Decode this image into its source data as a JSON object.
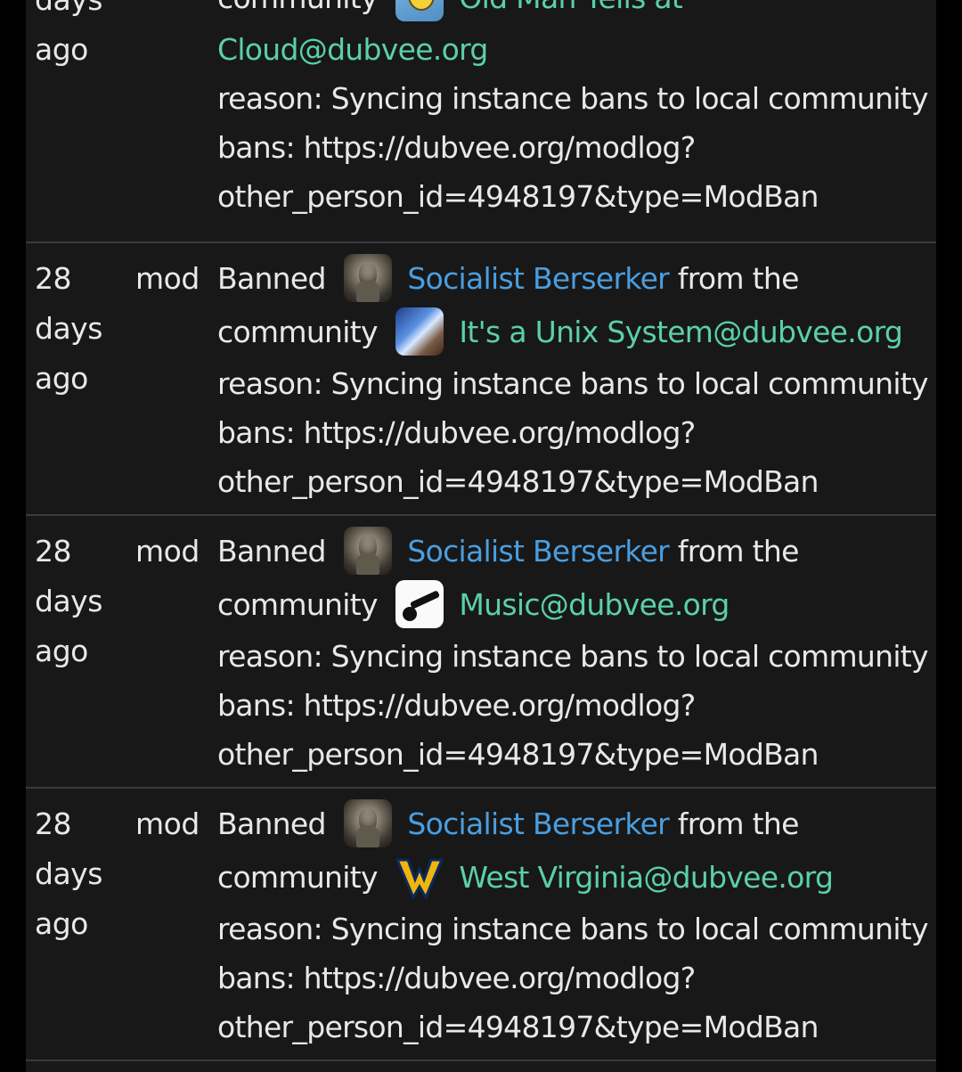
{
  "top_partial": {
    "time_lines": [
      "days",
      "ago"
    ],
    "community_word": "community",
    "community_avatar": "old-man-yells-avatar",
    "community_link_line1": "Old Man Yells at",
    "community_link_line2": "Cloud@dubvee.org",
    "reason_line1": "reason: Syncing instance bans to local community",
    "reason_line2": "bans: https://dubvee.org/modlog?",
    "reason_line3": "other_person_id=4948197&type=ModBan"
  },
  "entries": [
    {
      "time_lines": [
        "28",
        "days",
        "ago"
      ],
      "role": "mod",
      "banned_word": "Banned",
      "user": "Socialist Berserker",
      "from_the": "from the",
      "community_word": "community",
      "community": "It's a Unix System@dubvee.org",
      "community_avatar": "unix-system-avatar",
      "reason_line1": "reason: Syncing instance bans to local community",
      "reason_line2": "bans: https://dubvee.org/modlog?",
      "reason_line3": "other_person_id=4948197&type=ModBan"
    },
    {
      "time_lines": [
        "28",
        "days",
        "ago"
      ],
      "role": "mod",
      "banned_word": "Banned",
      "user": "Socialist Berserker",
      "from_the": "from the",
      "community_word": "community",
      "community": "Music@dubvee.org",
      "community_avatar": "music-guitar-avatar",
      "reason_line1": "reason: Syncing instance bans to local community",
      "reason_line2": "bans: https://dubvee.org/modlog?",
      "reason_line3": "other_person_id=4948197&type=ModBan"
    },
    {
      "time_lines": [
        "28",
        "days",
        "ago"
      ],
      "role": "mod",
      "banned_word": "Banned",
      "user": "Socialist Berserker",
      "from_the": "from the",
      "community_word": "community",
      "community": "West Virginia@dubvee.org",
      "community_avatar": "west-virginia-logo",
      "reason_line1": "reason: Syncing instance bans to local community",
      "reason_line2": "bans: https://dubvee.org/modlog?",
      "reason_line3": "other_person_id=4948197&type=ModBan"
    }
  ],
  "colors": {
    "background": "#000000",
    "panel": "#181818",
    "text": "#e8e8e8",
    "user_link": "#4a9ee0",
    "community_link": "#5bd0a8",
    "divider": "#3a3a3a"
  }
}
